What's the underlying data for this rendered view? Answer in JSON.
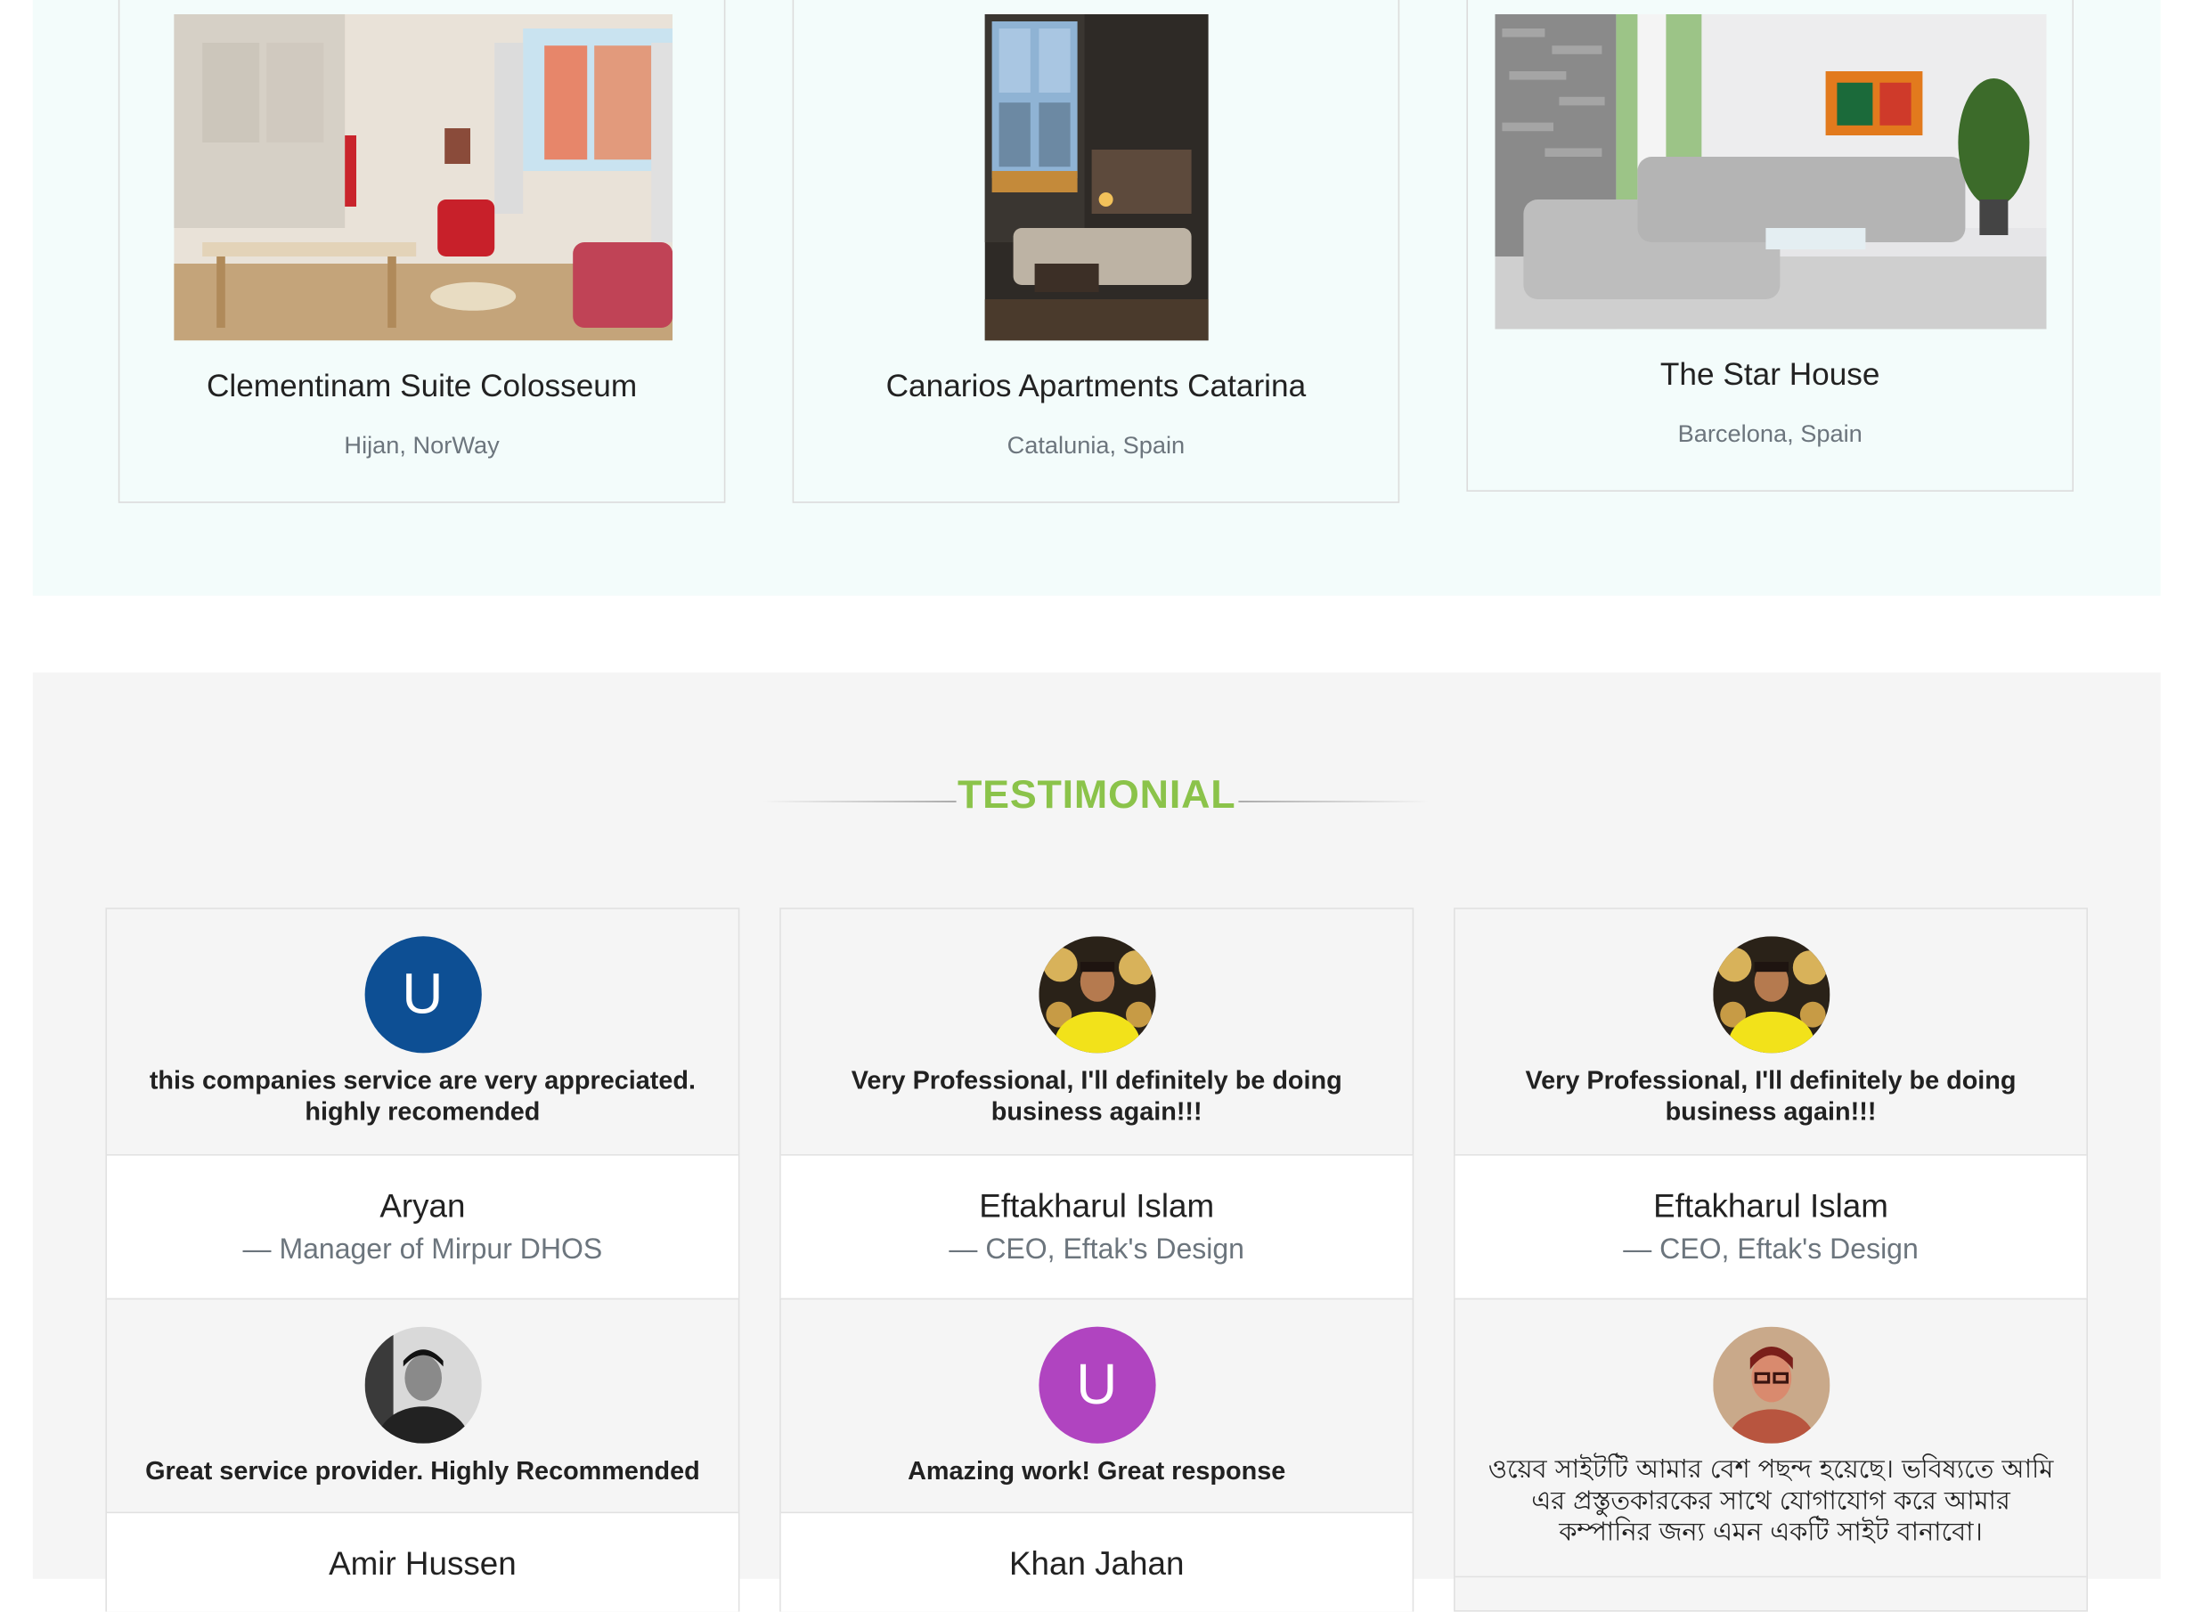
{
  "properties": [
    {
      "name": "Clementinam Suite Colosseum",
      "location": "Hijan, NorWay"
    },
    {
      "name": "Canarios Apartments Catarina",
      "location": "Catalunia, Spain"
    },
    {
      "name": "The Star House",
      "location": "Barcelona, Spain"
    }
  ],
  "testimonial": {
    "title": "TESTIMONIAL",
    "items": [
      {
        "avatar_letter": "U",
        "avatar_color": "#0d4f94",
        "quote": "this companies service are very appreciated. highly recomended",
        "name": "Aryan",
        "role": "— Manager of Mirpur DHOS"
      },
      {
        "quote": "Very Professional, I'll definitely be doing business again!!!",
        "name": "Eftakharul Islam",
        "role": "— CEO, Eftak's Design"
      },
      {
        "quote": "Very Professional, I'll definitely be doing business again!!!",
        "name": "Eftakharul Islam",
        "role": "— CEO, Eftak's Design"
      },
      {
        "quote": "Great service provider. Highly Recommended",
        "name": "Amir Hussen"
      },
      {
        "avatar_letter": "U",
        "avatar_color": "#b044c0",
        "quote": "Amazing work! Great response",
        "name": "Khan Jahan"
      },
      {
        "quote": "ওয়েব সাইটটি আমার বেশ পছন্দ হয়েছে। ভবিষ্যতে আমি এর প্রস্তুতকারকের সাথে যোগাযোগ করে আমার কম্পানির জন্য এমন একটি সাইট বানাবো।"
      }
    ]
  }
}
